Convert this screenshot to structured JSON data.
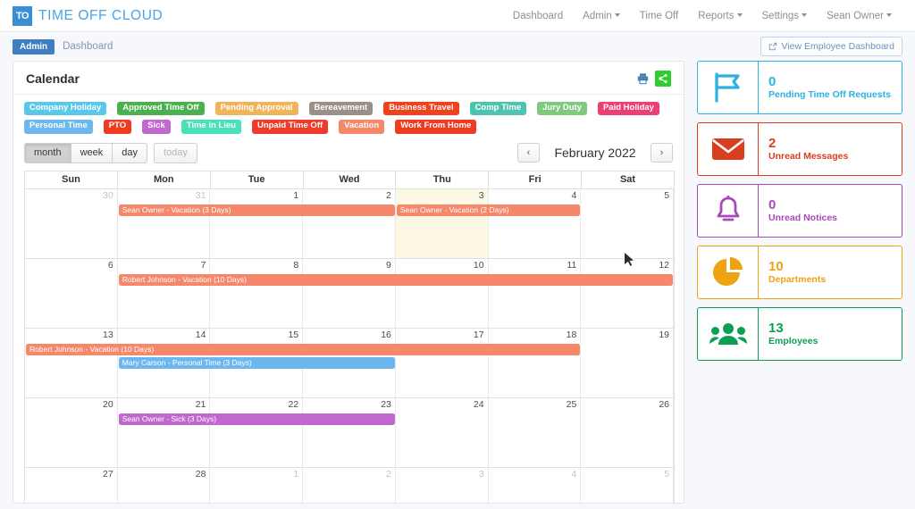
{
  "brand": {
    "mark": "TO",
    "name": "TIME OFF CLOUD",
    "mark_color": "#3a8fd4",
    "text_color": "#45a3e8"
  },
  "topnav": {
    "links": [
      {
        "label": "Dashboard",
        "caret": false
      },
      {
        "label": "Admin",
        "caret": true
      },
      {
        "label": "Time Off",
        "caret": false
      },
      {
        "label": "Reports",
        "caret": true
      },
      {
        "label": "Settings",
        "caret": true
      },
      {
        "label": "Sean Owner",
        "caret": true
      }
    ]
  },
  "breadcrumb": {
    "badge": "Admin",
    "text": "Dashboard",
    "employee_dashboard_button": "View Employee Dashboard",
    "external-link-icon": "external-link-icon"
  },
  "panel": {
    "title": "Calendar",
    "print_icon": "print-icon",
    "share_icon": "share-icon"
  },
  "legend": {
    "tags": [
      {
        "label": "Company Holiday",
        "color": "#5bc8ea"
      },
      {
        "label": "Approved Time Off",
        "color": "#4cb050"
      },
      {
        "label": "Pending Approval",
        "color": "#f0b45a"
      },
      {
        "label": "Bereavement",
        "color": "#9b9088"
      },
      {
        "label": "Business Travel",
        "color": "#f0411f"
      },
      {
        "label": "Comp Time",
        "color": "#4fc3b0"
      },
      {
        "label": "Jury Duty",
        "color": "#7fc87f"
      },
      {
        "label": "Paid Holiday",
        "color": "#ec3f72"
      },
      {
        "label": "Personal Time",
        "color": "#6cb8ee"
      },
      {
        "label": "PTO",
        "color": "#f03b1f"
      },
      {
        "label": "Sick",
        "color": "#c068cd"
      },
      {
        "label": "Time in Lieu",
        "color": "#4ae0b8"
      },
      {
        "label": "Unpaid Time Off",
        "color": "#ef3b2b"
      },
      {
        "label": "Vacation",
        "color": "#f5886b"
      },
      {
        "label": "Work From Home",
        "color": "#ef3b21"
      }
    ]
  },
  "calendar": {
    "views": [
      {
        "label": "month",
        "active": true
      },
      {
        "label": "week",
        "active": false
      },
      {
        "label": "day",
        "active": false
      }
    ],
    "today_label": "today",
    "prev_label": "‹",
    "next_label": "›",
    "title": "February 2022",
    "weekdays": [
      "Sun",
      "Mon",
      "Tue",
      "Wed",
      "Thu",
      "Fri",
      "Sat"
    ],
    "today_index": {
      "week": 0,
      "day": 4
    },
    "weeks": [
      {
        "days": [
          {
            "num": "30",
            "other": true
          },
          {
            "num": "31",
            "other": true
          },
          {
            "num": "1",
            "other": false
          },
          {
            "num": "2",
            "other": false
          },
          {
            "num": "3",
            "other": false,
            "today": true
          },
          {
            "num": "4",
            "other": false
          },
          {
            "num": "5",
            "other": false
          }
        ],
        "events": [
          {
            "label": "Sean Owner - Vacation (3 Days)",
            "color": "#f5886b",
            "start": 1,
            "span": 3,
            "row": 0
          },
          {
            "label": "Sean Owner - Vacation (2 Days)",
            "color": "#f5886b",
            "start": 4,
            "span": 2,
            "row": 0
          }
        ]
      },
      {
        "days": [
          {
            "num": "6",
            "other": false
          },
          {
            "num": "7",
            "other": false
          },
          {
            "num": "8",
            "other": false
          },
          {
            "num": "9",
            "other": false
          },
          {
            "num": "10",
            "other": false
          },
          {
            "num": "11",
            "other": false
          },
          {
            "num": "12",
            "other": false
          }
        ],
        "events": [
          {
            "label": "Robert Johnson - Vacation (10 Days)",
            "color": "#f5886b",
            "start": 1,
            "span": 6,
            "row": 0
          }
        ]
      },
      {
        "days": [
          {
            "num": "13",
            "other": false
          },
          {
            "num": "14",
            "other": false
          },
          {
            "num": "15",
            "other": false
          },
          {
            "num": "16",
            "other": false
          },
          {
            "num": "17",
            "other": false
          },
          {
            "num": "18",
            "other": false
          },
          {
            "num": "19",
            "other": false
          }
        ],
        "events": [
          {
            "label": "Robert Johnson - Vacation (10 Days)",
            "color": "#f5886b",
            "start": 0,
            "span": 6,
            "row": 0
          },
          {
            "label": "Mary Carson - Personal Time (3 Days)",
            "color": "#6cb8ee",
            "start": 1,
            "span": 3,
            "row": 1
          }
        ]
      },
      {
        "days": [
          {
            "num": "20",
            "other": false
          },
          {
            "num": "21",
            "other": false
          },
          {
            "num": "22",
            "other": false
          },
          {
            "num": "23",
            "other": false
          },
          {
            "num": "24",
            "other": false
          },
          {
            "num": "25",
            "other": false
          },
          {
            "num": "26",
            "other": false
          }
        ],
        "events": [
          {
            "label": "Sean Owner - Sick (3 Days)",
            "color": "#c068cd",
            "start": 1,
            "span": 3,
            "row": 0
          }
        ]
      },
      {
        "days": [
          {
            "num": "27",
            "other": false
          },
          {
            "num": "28",
            "other": false
          },
          {
            "num": "1",
            "other": true
          },
          {
            "num": "2",
            "other": true
          },
          {
            "num": "3",
            "other": true
          },
          {
            "num": "4",
            "other": true
          },
          {
            "num": "5",
            "other": true
          }
        ],
        "events": [],
        "short": true
      }
    ]
  },
  "cards": [
    {
      "num": "0",
      "label": "Pending Time Off Requests",
      "color": "#2bb2e0",
      "icon": "flag-icon"
    },
    {
      "num": "2",
      "label": "Unread Messages",
      "color": "#d93f1f",
      "icon": "envelope-icon"
    },
    {
      "num": "0",
      "label": "Unread Notices",
      "color": "#a64bb5",
      "icon": "bell-icon"
    },
    {
      "num": "10",
      "label": "Departments",
      "color": "#f0a312",
      "icon": "pie-chart-icon"
    },
    {
      "num": "13",
      "label": "Employees",
      "color": "#0aa054",
      "icon": "users-icon"
    }
  ]
}
